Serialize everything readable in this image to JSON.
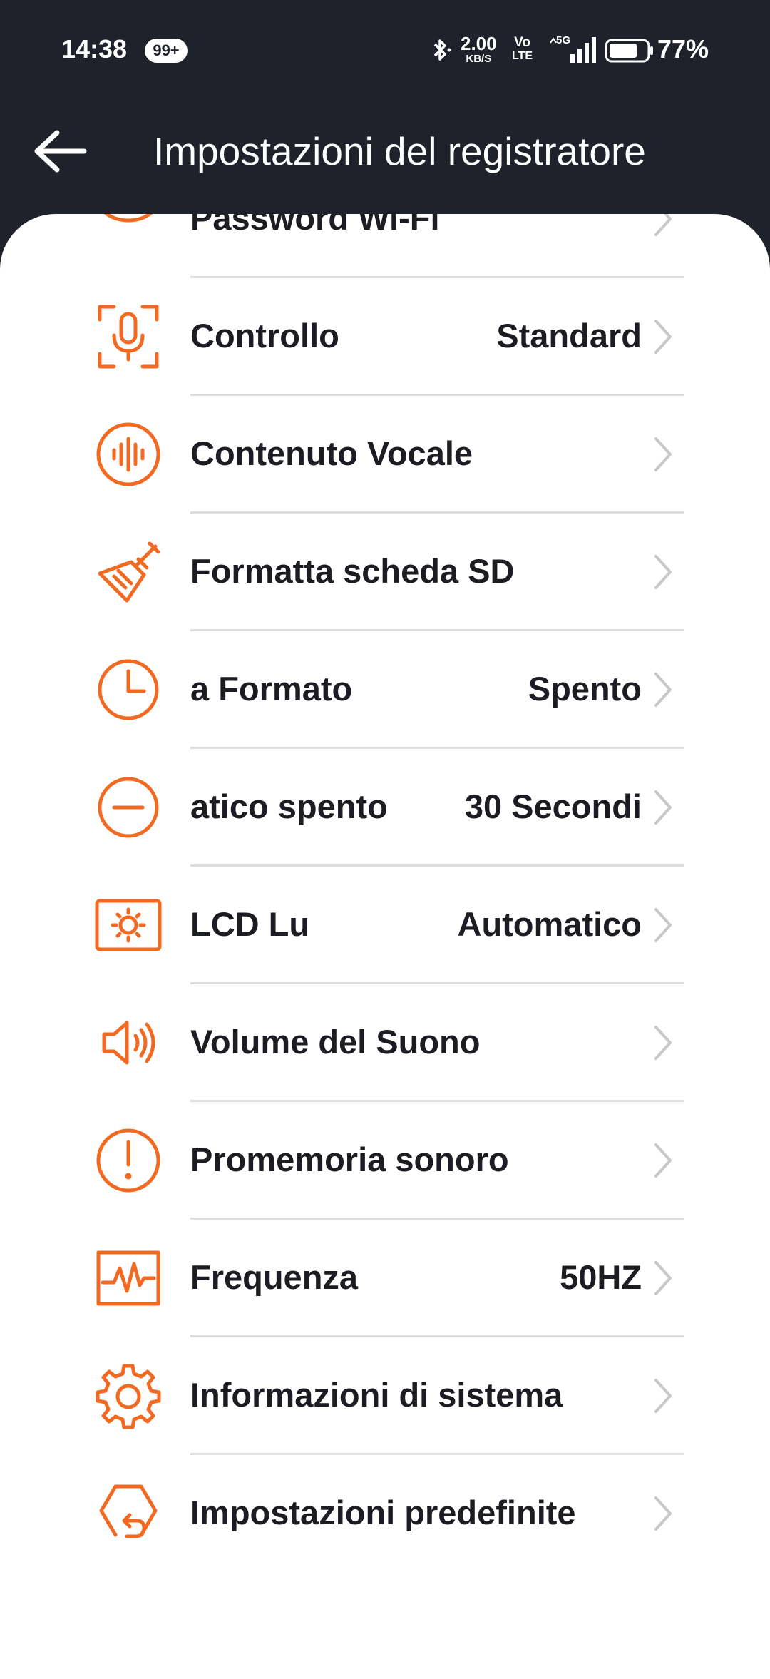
{
  "status_bar": {
    "time": "14:38",
    "notification_badge": "99+",
    "bluetooth_icon": "bluetooth-icon",
    "net_speed_value": "2.00",
    "net_speed_unit": "KB/S",
    "volte_top": "Vo",
    "volte_bottom": "LTE",
    "network": "5G",
    "battery_percent": "77%",
    "battery_level": 0.77
  },
  "header": {
    "back_icon": "arrow-left-icon",
    "title": "Impostazioni del registratore"
  },
  "colors": {
    "header_bg": "#1f222b",
    "accent": "#f26a21",
    "text": "#1c1d22",
    "divider": "#dedede",
    "chevron": "#c8c8c8"
  },
  "settings": [
    {
      "icon": "wifi-icon",
      "label": "Password Wi-Fi",
      "value": ""
    },
    {
      "icon": "voice-control-icon",
      "label": "Controllo",
      "value": "Standard"
    },
    {
      "icon": "voice-wave-icon",
      "label": "Contenuto Vocale",
      "value": ""
    },
    {
      "icon": "broom-icon",
      "label": "Formatta scheda SD",
      "value": ""
    },
    {
      "icon": "clock-icon",
      "label": "a Formato",
      "value": "Spento"
    },
    {
      "icon": "minus-circle-icon",
      "label": "atico spento",
      "value": "30 Secondi"
    },
    {
      "icon": "brightness-icon",
      "label": "LCD      Lu",
      "value": "Automatico"
    },
    {
      "icon": "speaker-icon",
      "label": "Volume del Suono",
      "value": ""
    },
    {
      "icon": "alert-icon",
      "label": "Promemoria sonoro",
      "value": ""
    },
    {
      "icon": "frequency-icon",
      "label": "Frequenza",
      "value": "50HZ"
    },
    {
      "icon": "gear-icon",
      "label": "Informazioni di sistema",
      "value": ""
    },
    {
      "icon": "reset-icon",
      "label": "Impostazioni predefinite",
      "value": ""
    }
  ]
}
